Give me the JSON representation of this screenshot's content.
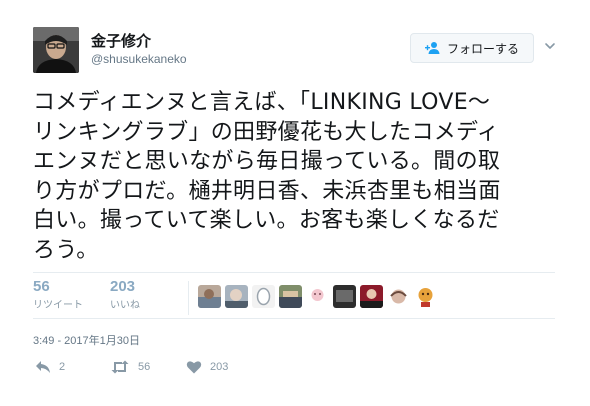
{
  "author": {
    "display_name": "金子修介",
    "handle": "@shusukekaneko",
    "avatar_icon": "person-photo-icon"
  },
  "follow_button": {
    "label": "フォローする",
    "icon": "add-user-icon"
  },
  "tweet": {
    "lines": [
      "コメディエンヌと言えば、「LINKING LOVE〜",
      "リンキングラブ」の田野優花も大したコメディ",
      "エンヌだと思いながら毎日撮っている。間の取",
      "り方がプロだ。樋井明日香、未浜杏里も相当面",
      "白い。撮っていて楽しい。お客も楽しくなるだ",
      "ろう。"
    ]
  },
  "stats": {
    "retweets": {
      "count": "56",
      "label": "リツイート"
    },
    "likes": {
      "count": "203",
      "label": "いいね"
    }
  },
  "likers_count_shown": 10,
  "timestamp": "3:49 - 2017年1月30日",
  "actions": {
    "reply": {
      "icon": "reply-icon",
      "count": "2"
    },
    "retweet": {
      "icon": "retweet-icon",
      "count": "56"
    },
    "like": {
      "icon": "heart-icon",
      "count": "203"
    }
  },
  "colors": {
    "text": "#14171a",
    "secondary": "#657786",
    "stat_number": "#8aa9c2",
    "divider": "#e6ecf0"
  }
}
